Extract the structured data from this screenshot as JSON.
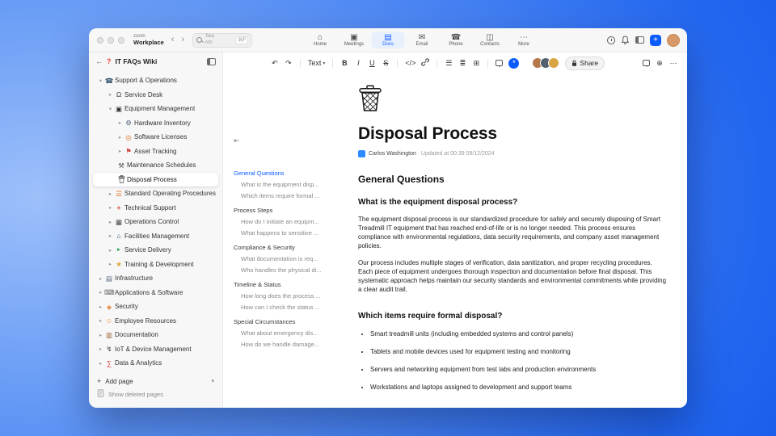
{
  "colors": {
    "accent": "#0b5cff"
  },
  "titlebar": {
    "brand_line1": "zoom",
    "brand_line2": "Workplace",
    "search": {
      "placeholder": "Search",
      "shortcut": "⌘F"
    },
    "tabs": [
      {
        "label": "Home",
        "glyph": "⌂"
      },
      {
        "label": "Meetings",
        "glyph": "▣"
      },
      {
        "label": "Docs",
        "glyph": "▤"
      },
      {
        "label": "Email",
        "glyph": "✉"
      },
      {
        "label": "Phone",
        "glyph": "☎"
      },
      {
        "label": "Contacts",
        "glyph": "◫"
      },
      {
        "label": "More",
        "glyph": "⋯"
      }
    ]
  },
  "icons": {
    "nav_back": "‹",
    "nav_forward": "›",
    "back_arrow": "←",
    "question_badge": "?",
    "chevron_right": "▸",
    "chevron_down": "▾",
    "caret_down": "▾",
    "plus": "+",
    "undo": "↶",
    "redo": "↷",
    "code": "</>",
    "bullet_list": "☰",
    "numbered_list": "≣",
    "table": "⊞",
    "globe": "⊕",
    "more": "⋯",
    "collapse_outline": "⇤",
    "ai": "*"
  },
  "sidebar": {
    "title": "IT FAQs Wiki",
    "add_page_label": "Add page",
    "show_deleted_label": "Show deleted pages",
    "tree": [
      {
        "label": "Support & Operations",
        "glyph": "☎"
      },
      {
        "label": "Service Desk",
        "glyph": "Ω"
      },
      {
        "label": "Equipment Management",
        "glyph": "▣"
      },
      {
        "label": "Hardware Inventory",
        "glyph": "⚙"
      },
      {
        "label": "Software Licenses",
        "glyph": "◎"
      },
      {
        "label": "Asset Tracking",
        "glyph": "⚑"
      },
      {
        "label": "Maintenance Schedules",
        "glyph": "⚒"
      },
      {
        "label": "Disposal Process",
        "glyph": ""
      },
      {
        "label": "Standard Operating Procedures",
        "glyph": "☰"
      },
      {
        "label": "Technical Support",
        "glyph": "+"
      },
      {
        "label": "Operations Control",
        "glyph": "▦"
      },
      {
        "label": "Facilities Management",
        "glyph": "⌂"
      },
      {
        "label": "Service Delivery",
        "glyph": "►"
      },
      {
        "label": "Training & Development",
        "glyph": "★"
      },
      {
        "label": "Infrastructure",
        "glyph": "▤"
      },
      {
        "label": "Applications & Software",
        "glyph": "⌨"
      },
      {
        "label": "Security",
        "glyph": "◈"
      },
      {
        "label": "Employee Resources",
        "glyph": "☺"
      },
      {
        "label": "Documentation",
        "glyph": "▥"
      },
      {
        "label": "IoT & Device Management",
        "glyph": "↯"
      },
      {
        "label": "Data & Analytics",
        "glyph": "∑"
      }
    ]
  },
  "toolbar": {
    "text_style_label": "Text",
    "bold": "B",
    "italic": "I",
    "underline": "U",
    "strike": "S",
    "share_label": "Share"
  },
  "toc": {
    "sections": [
      {
        "title": "General Questions",
        "active": true,
        "items": [
          "What is the equipment disp...",
          "Which items require formal ..."
        ]
      },
      {
        "title": "Process Steps",
        "active": false,
        "items": [
          "How do I initiate an equipm...",
          "What happens to sensitive ..."
        ]
      },
      {
        "title": "Compliance & Security",
        "active": false,
        "items": [
          "What documentation is req...",
          "Who handles the physical di..."
        ]
      },
      {
        "title": "Timeline & Status",
        "active": false,
        "items": [
          "How long does the process ...",
          "How can I check the status ..."
        ]
      },
      {
        "title": "Special Circumstances",
        "active": false,
        "items": [
          "What about emergency dis...",
          "How do we handle damage..."
        ]
      }
    ]
  },
  "doc": {
    "title": "Disposal Process",
    "author": "Carlos Washington",
    "updated": "Updated at 00:39 09/12/2024",
    "heading": "General Questions",
    "q1": "What is the equipment disposal process?",
    "p1": "The equipment disposal process is our standardized procedure for safely and securely disposing of Smart Treadmill IT equipment that has reached end-of-life or is no longer needed. This process ensures compliance with environmental regulations, data security requirements, and company asset management policies.",
    "p2": "Our process includes multiple stages of verification, data sanitization, and proper recycling procedures. Each piece of equipment undergoes thorough inspection and documentation before final disposal. This systematic approach helps maintain our security standards and environmental commitments while providing a clear audit trail.",
    "q2": "Which items require formal disposal?",
    "bullets": [
      "Smart treadmill units (including embedded systems and control panels)",
      "Tablets and mobile devices used for equipment testing and monitoring",
      "Servers and networking equipment from test labs and production environments",
      "Workstations and laptops assigned to development and support teams"
    ]
  }
}
